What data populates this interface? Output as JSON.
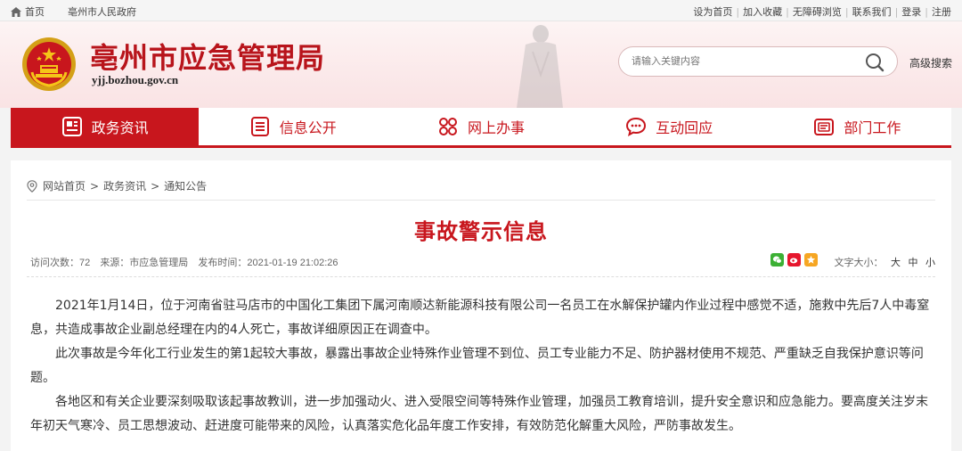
{
  "topbar": {
    "home": "首页",
    "city_gov": "亳州市人民政府",
    "links": [
      "设为首页",
      "加入收藏",
      "无障碍浏览",
      "联系我们",
      "登录",
      "注册"
    ]
  },
  "header": {
    "site_title": "亳州市应急管理局",
    "site_url": "yjj.bozhou.gov.cn",
    "search_placeholder": "请输入关键内容",
    "advanced_search": "高级搜索"
  },
  "nav": {
    "items": [
      {
        "label": "政务资讯",
        "icon": "news-icon",
        "active": true
      },
      {
        "label": "信息公开",
        "icon": "list-doc-icon",
        "active": false
      },
      {
        "label": "网上办事",
        "icon": "grid-cloud-icon",
        "active": false
      },
      {
        "label": "互动回应",
        "icon": "chat-icon",
        "active": false
      },
      {
        "label": "部门工作",
        "icon": "folder-doc-icon",
        "active": false
      }
    ]
  },
  "breadcrumb": {
    "items": [
      "网站首页",
      "政务资讯",
      "通知公告"
    ],
    "separator": ">"
  },
  "article": {
    "title": "事故警示信息",
    "visits": "访问次数：72",
    "source": "来源：市应急管理局",
    "published": "发布时间：2021-01-19 21:02:26",
    "font_size_label": "文字大小：",
    "font_sizes": [
      "大",
      "中",
      "小"
    ],
    "share_icons": [
      "wechat-icon",
      "weibo-icon",
      "qzone-icon"
    ],
    "paragraphs": [
      "2021年1月14日，位于河南省驻马店市的中国化工集团下属河南顺达新能源科技有限公司一名员工在水解保护罐内作业过程中感觉不适，施救中先后7人中毒窒息，共造成事故企业副总经理在内的4人死亡，事故详细原因正在调查中。",
      "此次事故是今年化工行业发生的第1起较大事故，暴露出事故企业特殊作业管理不到位、员工专业能力不足、防护器材使用不规范、严重缺乏自我保护意识等问题。",
      "各地区和有关企业要深刻吸取该起事故教训，进一步加强动火、进入受限空间等特殊作业管理，加强员工教育培训，提升安全意识和应急能力。要高度关注岁末年初天气寒冷、员工思想波动、赶进度可能带来的风险，认真落实危化品年度工作安排，有效防范化解重大风险，严防事故发生。"
    ]
  },
  "colors": {
    "brand_red": "#c8161d",
    "title_red": "#b8141b"
  }
}
